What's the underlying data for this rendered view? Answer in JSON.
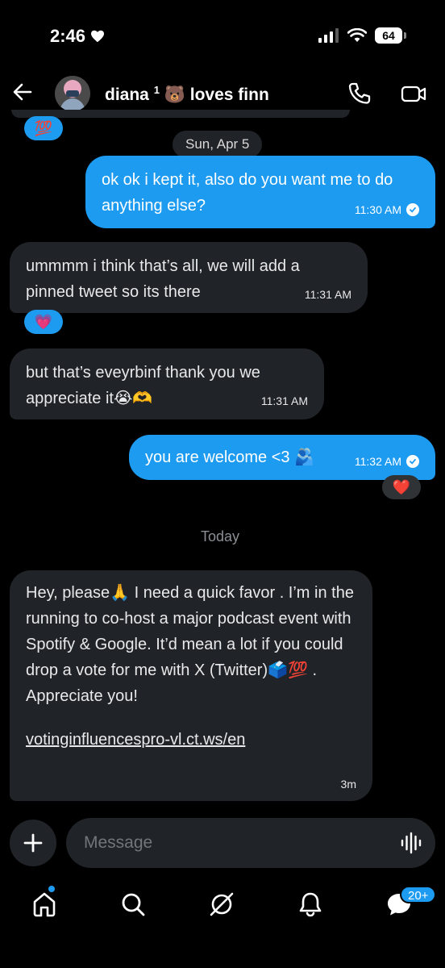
{
  "status_bar": {
    "time": "2:46",
    "battery": "64"
  },
  "header": {
    "name": "diana",
    "name_sup": "1",
    "name_suffix": "🐻 loves finn"
  },
  "messages": {
    "top_reaction": "💯",
    "date_sun": "Sun, Apr 5",
    "m1": {
      "text": "ok ok i kept it, also do you want me to do anything else?",
      "time": "11:30 AM"
    },
    "m2": {
      "text": "ummmm i think that’s all, we will add a pinned tweet so its there",
      "time": "11:31 AM",
      "reaction": "💗"
    },
    "m3": {
      "text": "but that’s eveyrbinf thank you we appreciate it😭🫶",
      "time": "11:31 AM"
    },
    "m4": {
      "text": "you are welcome <3 🫂",
      "time": "11:32 AM",
      "reaction": "❤️"
    },
    "date_today": "Today",
    "m5": {
      "text": "Hey, please🙏 I need a quick favor . I’m in the running to co-host a major podcast event with Spotify & Google. It’d mean a lot if you could drop a vote for me with X (Twitter)🗳️💯 . Appreciate you!",
      "link": "votinginfluencespro-vl.ct.ws/en",
      "time": "3m"
    }
  },
  "composer": {
    "placeholder": "Message"
  },
  "nav": {
    "messages_badge": "20+"
  },
  "colors": {
    "accent": "#1d9bf0",
    "incoming_bubble": "#202327",
    "background": "#000000"
  }
}
